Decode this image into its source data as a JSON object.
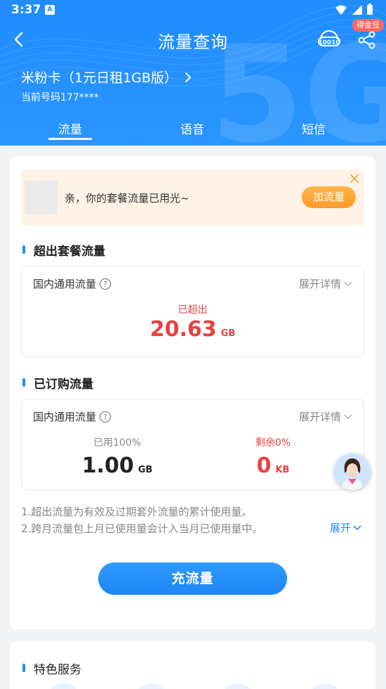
{
  "status_bar": {
    "time": "3:37"
  },
  "header": {
    "title": "流量查询",
    "badge": "得金豆",
    "plan_name": "米粉卡（1元日租1GB版）",
    "current_number": "当前号码177****",
    "service_icon": "customer-service-10010-icon",
    "share_icon": "share-icon",
    "tabs": [
      {
        "label": "流量",
        "active": true
      },
      {
        "label": "语音",
        "active": false
      },
      {
        "label": "短信",
        "active": false
      }
    ]
  },
  "notice": {
    "text": "亲，你的套餐流量已用光~",
    "button": "加流量"
  },
  "exceed_section": {
    "title": "超出套餐流量",
    "label": "国内通用流量",
    "expand": "展开详情",
    "status": "已超出",
    "value": "20.63",
    "unit": "GB"
  },
  "purchased_section": {
    "title": "已订购流量",
    "label": "国内通用流量",
    "expand": "展开详情",
    "used_label": "已用100%",
    "used_value": "1.00",
    "used_unit": "GB",
    "remain_label": "剩余0%",
    "remain_value": "0",
    "remain_unit": "KB"
  },
  "notes": {
    "line1": "1.超出流量为有效及过期套外流量的累计使用量。",
    "line2": "2.跨月流量包上月已使用量会计入当月已使用量中。",
    "expand": "展开"
  },
  "recharge_button": "充流量",
  "feature_section": {
    "title": "特色服务"
  },
  "colors": {
    "primary": "#1f8cff",
    "alert": "#e84141",
    "orange": "#ff9a2b"
  }
}
